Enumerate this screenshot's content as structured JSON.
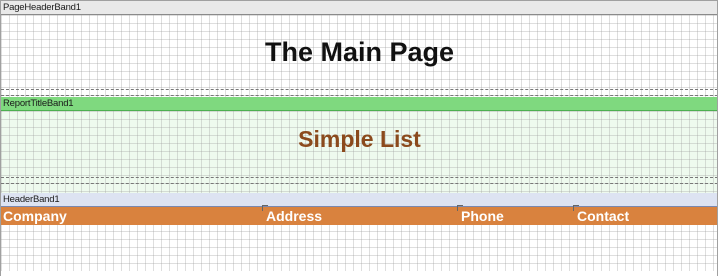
{
  "bands": {
    "page_header": {
      "name": "PageHeaderBand1",
      "title": "The Main Page"
    },
    "report_title": {
      "name": "ReportTitleBand1",
      "title": "Simple List"
    },
    "header": {
      "name": "HeaderBand1",
      "columns": [
        "Company",
        "Address",
        "Phone",
        "Contact"
      ]
    }
  },
  "colors": {
    "report_title_band": "#7fd97f",
    "header_strip": "#d9823e",
    "title_text": "#8b4a1c"
  }
}
